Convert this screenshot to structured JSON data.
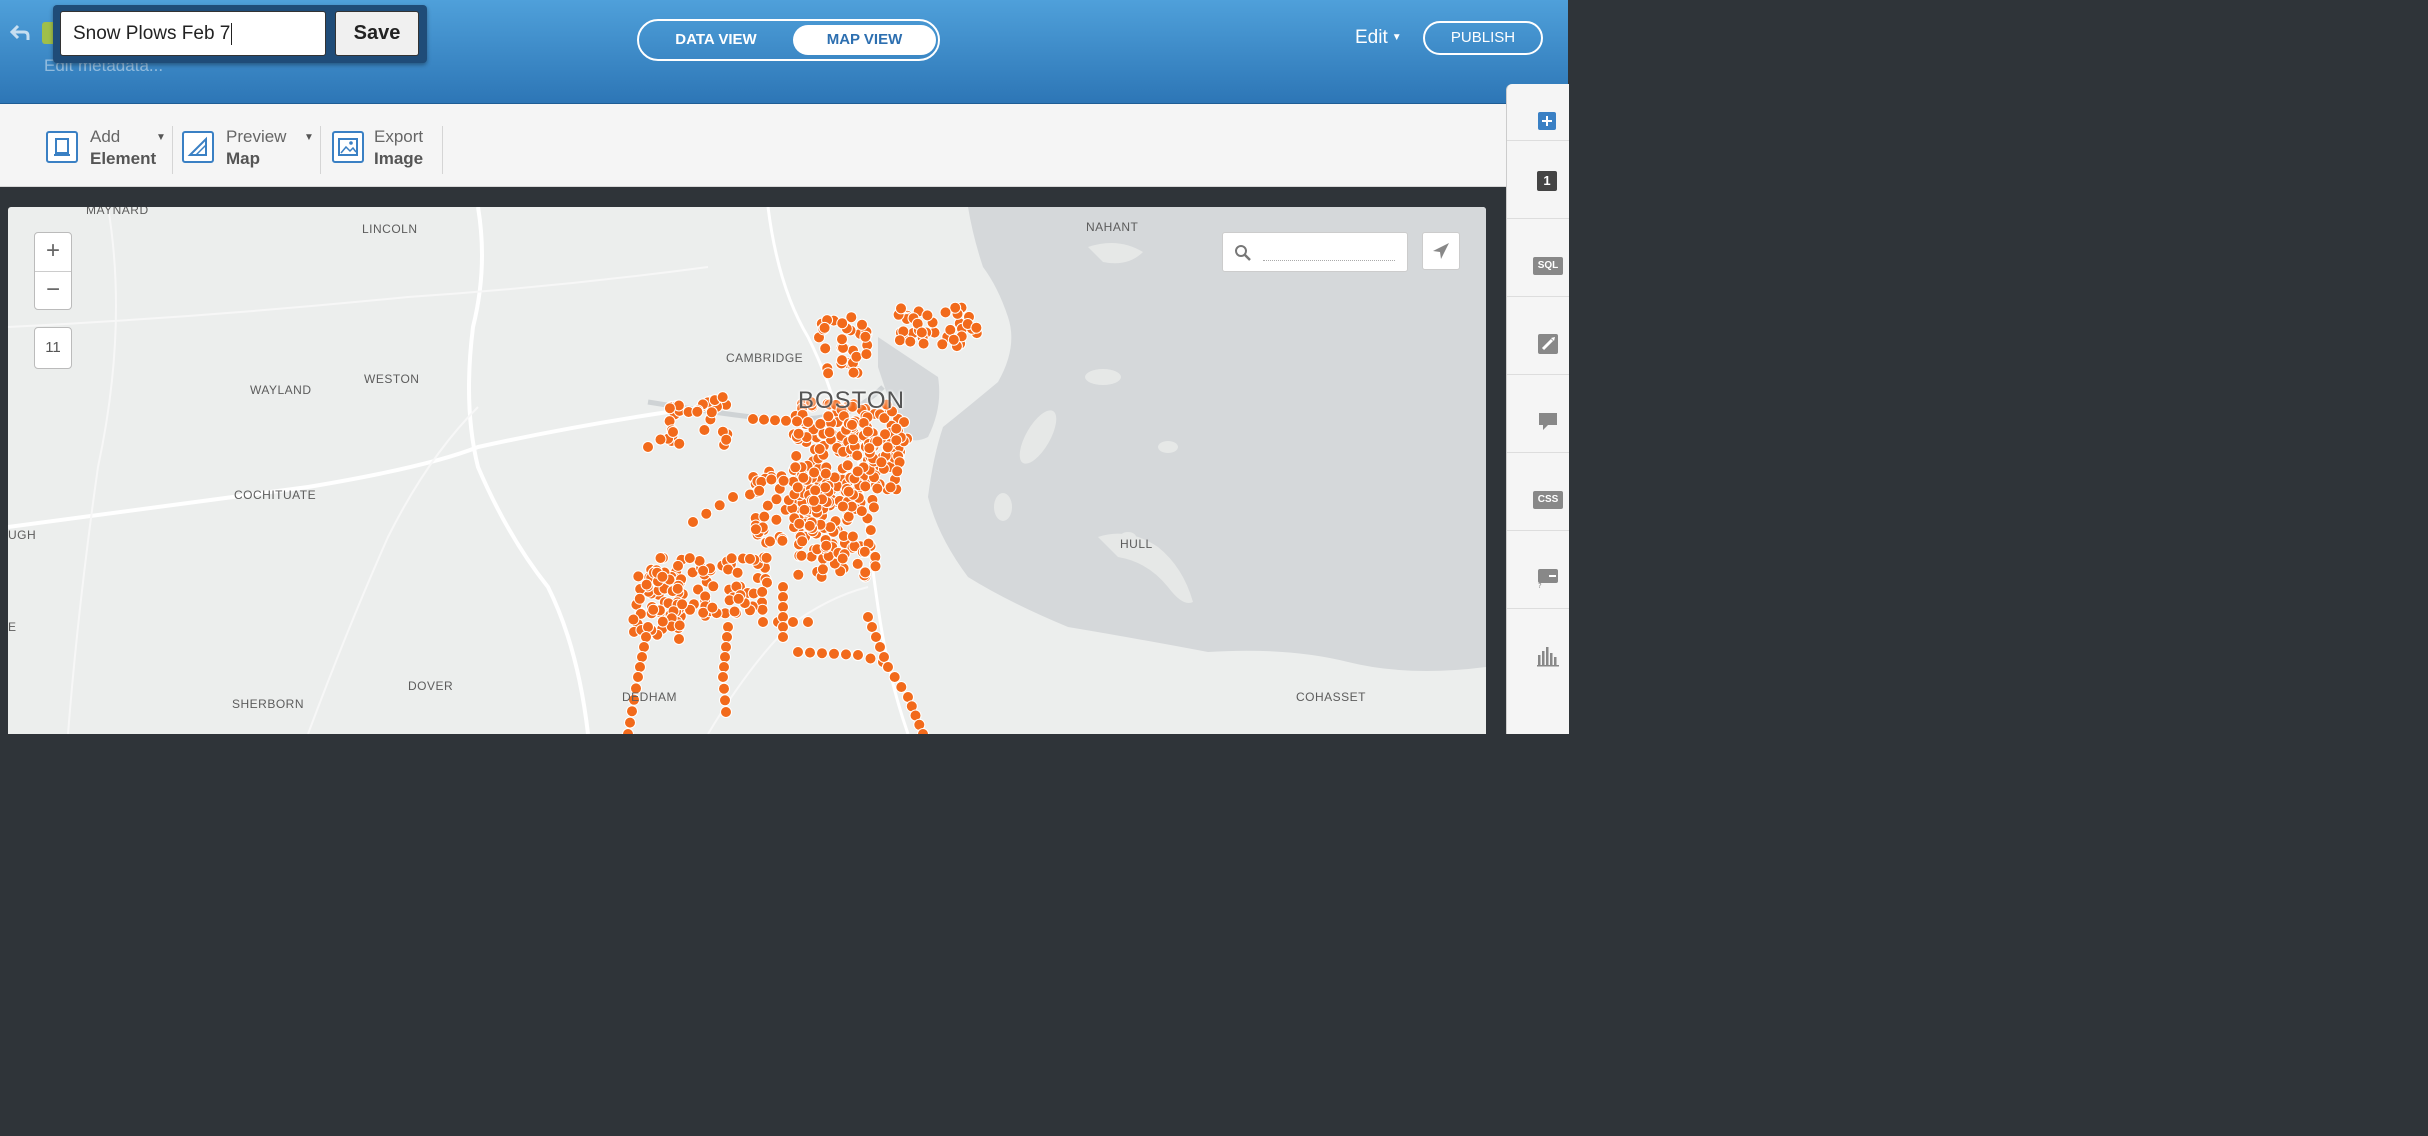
{
  "header": {
    "title_value": "Snow Plows Feb 7",
    "save_label": "Save",
    "edit_metadata": "Edit metadata...",
    "tabs": [
      {
        "label": "DATA VIEW",
        "active": false
      },
      {
        "label": "MAP VIEW",
        "active": true
      }
    ],
    "edit_label": "Edit",
    "publish_label": "PUBLISH"
  },
  "toolbar": {
    "add_element": {
      "line1": "Add",
      "line2": "Element"
    },
    "preview_map": {
      "line1": "Preview",
      "line2": "Map"
    },
    "export_image": {
      "line1": "Export",
      "line2": "Image"
    }
  },
  "map": {
    "zoom_in": "+",
    "zoom_out": "−",
    "zoom_level": "11",
    "search_placeholder": "",
    "point_color": "#f26a1b",
    "places": {
      "maynard": "MAYNARD",
      "lincoln": "LINCOLN",
      "nahant": "NAHANT",
      "cambridge": "CAMBRIDGE",
      "boston": "BOSTON",
      "wayland": "WAYLAND",
      "weston": "WESTON",
      "cochituate": "COCHITUATE",
      "ugh": "UGH",
      "hull": "HULL",
      "e_edge": "E",
      "sherborn": "SHERBORN",
      "dover": "DOVER",
      "dedham": "DEDHAM",
      "cohasset": "COHASSET"
    }
  },
  "right_panel": {
    "add_icon": "plus-icon",
    "layer_number": "1",
    "sql_label": "SQL",
    "css_label": "CSS",
    "items": [
      "wizard-icon",
      "infowindow-icon",
      "legend-icon",
      "widgets-icon"
    ]
  }
}
